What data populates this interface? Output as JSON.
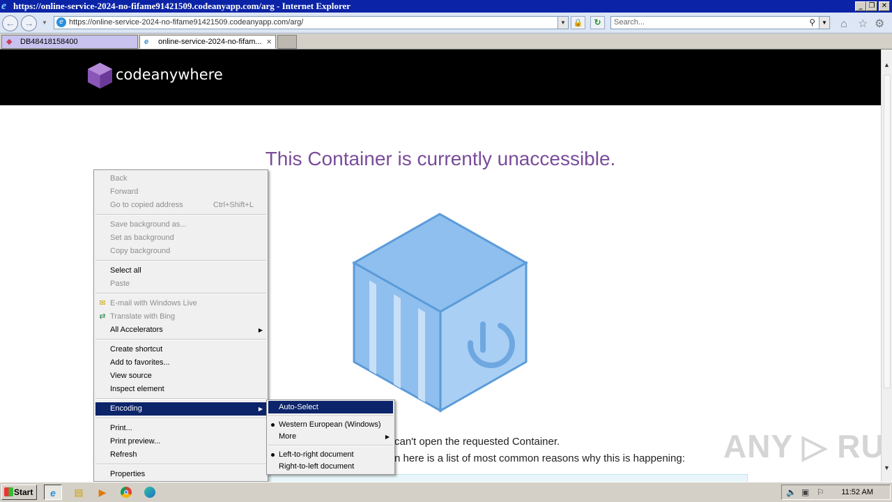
{
  "window": {
    "title": "https://online-service-2024-no-fifame91421509.codeanyapp.com/arg - Internet Explorer",
    "min_label": "_",
    "restore_label": "❐",
    "close_label": "✕"
  },
  "navbar": {
    "back_glyph": "←",
    "forward_glyph": "→",
    "url": "https://online-service-2024-no-fifame91421509.codeanyapp.com/arg/",
    "search_placeholder": "Search...",
    "lock_glyph": "🔒",
    "refresh_glyph": "↻",
    "home_glyph": "⌂",
    "star_glyph": "☆",
    "gear_glyph": "⚙"
  },
  "tabs": [
    {
      "label": "DB48418158400",
      "active": false
    },
    {
      "label": "online-service-2024-no-fifam...",
      "active": true,
      "close": "×"
    }
  ],
  "page": {
    "brand": "codeanywhere",
    "headline": "This Container is currently unaccessible.",
    "para1": "can't open the requested Container.",
    "para2": "n here is a list of most common reasons why this is happening:",
    "watermark": "ANY ▷ RUN"
  },
  "context_menu": {
    "items": [
      {
        "label": "Back",
        "disabled": true
      },
      {
        "label": "Forward",
        "disabled": true
      },
      {
        "label": "Go to copied address",
        "shortcut": "Ctrl+Shift+L",
        "disabled": true
      },
      {
        "label": "Save background as...",
        "disabled": true
      },
      {
        "label": "Set as background",
        "disabled": true
      },
      {
        "label": "Copy background",
        "disabled": true
      },
      {
        "label": "Select all",
        "disabled": false
      },
      {
        "label": "Paste",
        "disabled": true
      },
      {
        "label": "E-mail with Windows Live",
        "disabled": true,
        "icon": "mail-icon"
      },
      {
        "label": "Translate with Bing",
        "disabled": true,
        "icon": "translate-icon"
      },
      {
        "label": "All Accelerators",
        "disabled": false,
        "submenu": true
      },
      {
        "label": "Create shortcut",
        "disabled": false
      },
      {
        "label": "Add to favorites...",
        "disabled": false
      },
      {
        "label": "View source",
        "disabled": false
      },
      {
        "label": "Inspect element",
        "disabled": false
      },
      {
        "label": "Encoding",
        "disabled": false,
        "submenu": true,
        "highlighted": true
      },
      {
        "label": "Print...",
        "disabled": false
      },
      {
        "label": "Print preview...",
        "disabled": false
      },
      {
        "label": "Refresh",
        "disabled": false
      },
      {
        "label": "Properties",
        "disabled": false
      }
    ]
  },
  "encoding_menu": {
    "items": [
      {
        "label": "Auto-Select",
        "highlighted": true
      },
      {
        "label": "Western European (Windows)",
        "checked": true
      },
      {
        "label": "More",
        "submenu": true
      },
      {
        "label": "Left-to-right document",
        "checked": true
      },
      {
        "label": "Right-to-left document",
        "checked": false
      }
    ]
  },
  "taskbar": {
    "start_label": "Start",
    "clock": "11:52 AM"
  },
  "colors": {
    "titlebar": "#0b23a6",
    "menu_highlight": "#0c246a",
    "headline": "#7a4c99",
    "cube_light": "#a9cff5",
    "cube_mid": "#8fbfee",
    "cube_stroke": "#5b9bd9"
  }
}
